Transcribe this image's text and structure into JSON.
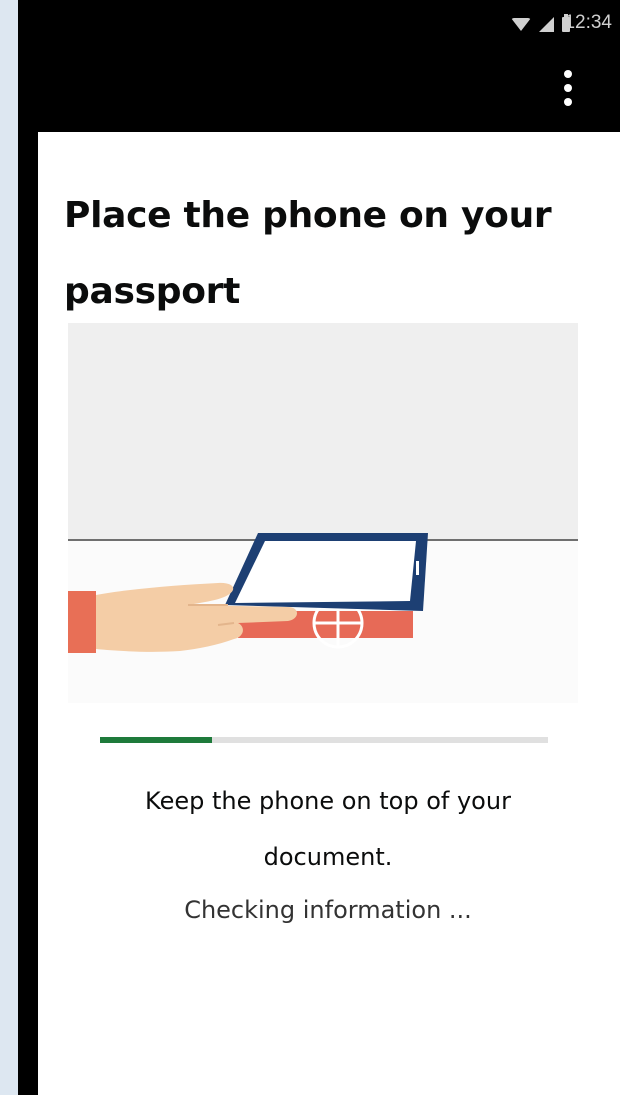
{
  "status_bar": {
    "time": "12:34",
    "icons": [
      "wifi-icon",
      "signal-icon",
      "battery-icon"
    ]
  },
  "toolbar": {
    "menu_icon": "overflow-menu-icon"
  },
  "page": {
    "title": "Place the phone on your passport",
    "instruction": "Keep the phone on top of your document.",
    "status": "Checking information ..."
  },
  "progress": {
    "value": 0.25,
    "color": "#1e7a3b",
    "track_color": "#e0e0e0"
  },
  "illustration": {
    "description_icon": "hand-phone-passport-illustration"
  }
}
